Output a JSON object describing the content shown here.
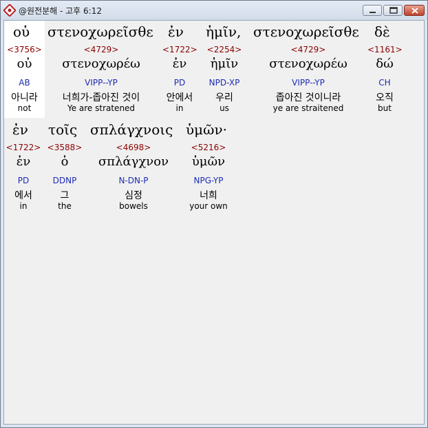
{
  "window": {
    "title": "@원전분해 - 고후 6:12",
    "buttons": {
      "minimize": "minimize",
      "maximize": "maximize",
      "close": "close"
    }
  },
  "colors": {
    "strong": "#8b0000",
    "morph": "#1c2ab5",
    "text": "#000000",
    "highlight": "#ffffff"
  },
  "words": [
    {
      "greek": "οὐ",
      "strong": "<3756>",
      "lemma": "οὐ",
      "morph": "AB",
      "korean": "아니라",
      "english": "not"
    },
    {
      "greek": "στενοχωρεῖσθε",
      "strong": "<4729>",
      "lemma": "στενοχωρέω",
      "morph": "VIPP--YP",
      "korean": "너희가-좁아진 것이",
      "english": "Ye are stratened"
    },
    {
      "greek": "ἐν",
      "strong": "<1722>",
      "lemma": "ἐν",
      "morph": "PD",
      "korean": "안에서",
      "english": "in"
    },
    {
      "greek": "ἡμῖν,",
      "strong": "<2254>",
      "lemma": "ἡμῖν",
      "morph": "NPD-XP",
      "korean": "우리",
      "english": "us"
    },
    {
      "greek": "στενοχωρεῖσθε",
      "strong": "<4729>",
      "lemma": "στενοχωρέω",
      "morph": "VIPP--YP",
      "korean": "좁아진 것이니라",
      "english": "ye are straitened"
    },
    {
      "greek": "δὲ",
      "strong": "<1161>",
      "lemma": "δώ",
      "morph": "CH",
      "korean": "오직",
      "english": "but"
    },
    {
      "greek": "ἐν",
      "strong": "<1722>",
      "lemma": "ἐν",
      "morph": "PD",
      "korean": "에서",
      "english": "in"
    },
    {
      "greek": "τοῖς",
      "strong": "<3588>",
      "lemma": "ὁ",
      "morph": "DDNP",
      "korean": "그",
      "english": "the"
    },
    {
      "greek": "σπλάγχνοις",
      "strong": "<4698>",
      "lemma": "σπλάγχνον",
      "morph": "N-DN-P",
      "korean": "심정",
      "english": "bowels"
    },
    {
      "greek": "ὑμῶν·",
      "strong": "<5216>",
      "lemma": "ὑμῶν",
      "morph": "NPG-YP",
      "korean": "너희",
      "english": "your own"
    }
  ]
}
